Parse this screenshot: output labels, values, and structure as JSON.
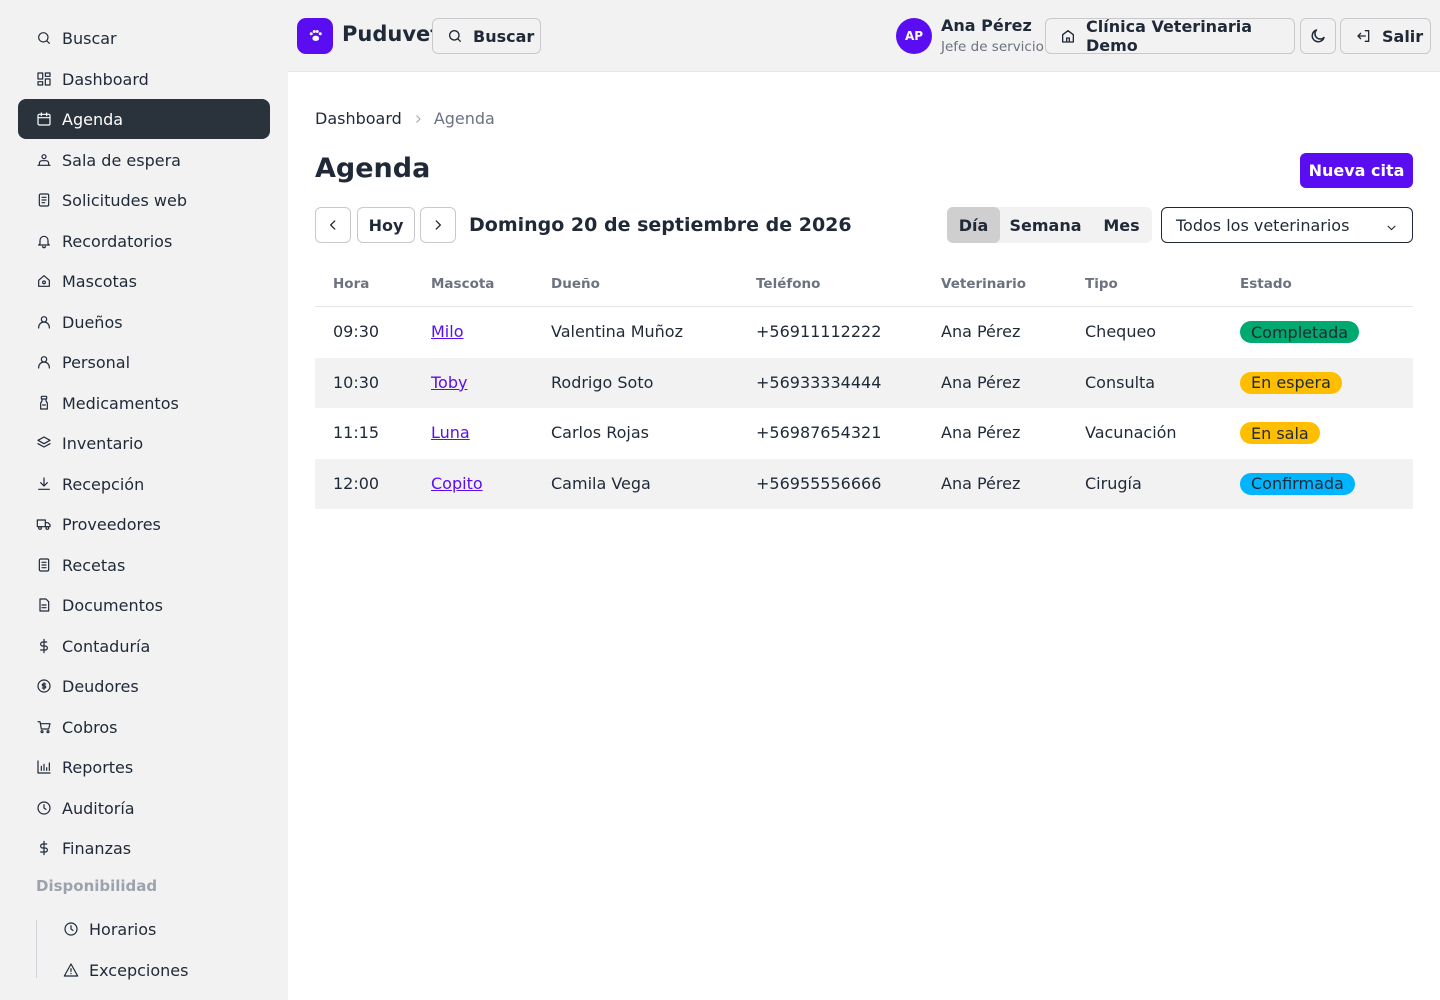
{
  "sidebar": {
    "items": [
      {
        "label": "Buscar",
        "icon": "search-icon"
      },
      {
        "label": "Dashboard",
        "icon": "dashboard-icon"
      },
      {
        "label": "Agenda",
        "icon": "calendar-icon",
        "active": true
      },
      {
        "label": "Sala de espera",
        "icon": "waiting-room-icon"
      },
      {
        "label": "Solicitudes web",
        "icon": "document-icon"
      },
      {
        "label": "Recordatorios",
        "icon": "bell-icon"
      },
      {
        "label": "Mascotas",
        "icon": "pet-icon"
      },
      {
        "label": "Dueños",
        "icon": "user-icon"
      },
      {
        "label": "Personal",
        "icon": "user-icon"
      },
      {
        "label": "Medicamentos",
        "icon": "medicine-icon"
      },
      {
        "label": "Inventario",
        "icon": "layers-icon"
      },
      {
        "label": "Recepción",
        "icon": "download-icon"
      },
      {
        "label": "Proveedores",
        "icon": "truck-icon"
      },
      {
        "label": "Recetas",
        "icon": "prescription-icon"
      },
      {
        "label": "Documentos",
        "icon": "file-icon"
      },
      {
        "label": "Contaduría",
        "icon": "dollar-icon"
      },
      {
        "label": "Deudores",
        "icon": "coin-icon"
      },
      {
        "label": "Cobros",
        "icon": "cart-icon"
      },
      {
        "label": "Reportes",
        "icon": "bar-chart-icon"
      },
      {
        "label": "Auditoría",
        "icon": "clock-icon"
      },
      {
        "label": "Finanzas",
        "icon": "dollar-icon"
      }
    ],
    "section_label": "Disponibilidad",
    "sub_items": [
      {
        "label": "Horarios",
        "icon": "clock-icon"
      },
      {
        "label": "Excepciones",
        "icon": "warning-icon"
      }
    ]
  },
  "topbar": {
    "brand": "Puduvet",
    "search_label": "Buscar",
    "user_initials": "AP",
    "user_name": "Ana Pérez",
    "user_role": "Jefe de servicio",
    "clinic_label": "Clínica Veterinaria Demo",
    "logout_label": "Salir"
  },
  "breadcrumb": {
    "root": "Dashboard",
    "current": "Agenda"
  },
  "page": {
    "title": "Agenda",
    "new_button": "Nueva cita",
    "today_button": "Hoy",
    "date_label": "Domingo 20 de septiembre de 2026",
    "views": [
      "Día",
      "Semana",
      "Mes"
    ],
    "active_view": "Día",
    "vet_filter": "Todos los veterinarios"
  },
  "table": {
    "headers": [
      "Hora",
      "Mascota",
      "Dueño",
      "Teléfono",
      "Veterinario",
      "Tipo",
      "Estado"
    ],
    "rows": [
      {
        "hora": "09:30",
        "mascota": "Milo",
        "dueno": "Valentina Muñoz",
        "telefono": "+56911112222",
        "veterinario": "Ana Pérez",
        "tipo": "Chequeo",
        "estado": "Completada",
        "estado_color": "#00a96e"
      },
      {
        "hora": "10:30",
        "mascota": "Toby",
        "dueno": "Rodrigo Soto",
        "telefono": "+56933334444",
        "veterinario": "Ana Pérez",
        "tipo": "Consulta",
        "estado": "En espera",
        "estado_color": "#ffbe00"
      },
      {
        "hora": "11:15",
        "mascota": "Luna",
        "dueno": "Carlos Rojas",
        "telefono": "+56987654321",
        "veterinario": "Ana Pérez",
        "tipo": "Vacunación",
        "estado": "En sala",
        "estado_color": "#ffbe00"
      },
      {
        "hora": "12:00",
        "mascota": "Copito",
        "dueno": "Camila Vega",
        "telefono": "+56955556666",
        "veterinario": "Ana Pérez",
        "tipo": "Cirugía",
        "estado": "Confirmada",
        "estado_color": "#00b5ff"
      }
    ]
  },
  "colors": {
    "accent": "#5b0df2",
    "sidebar_active": "#2a323c",
    "surface": "#f2f2f2"
  }
}
